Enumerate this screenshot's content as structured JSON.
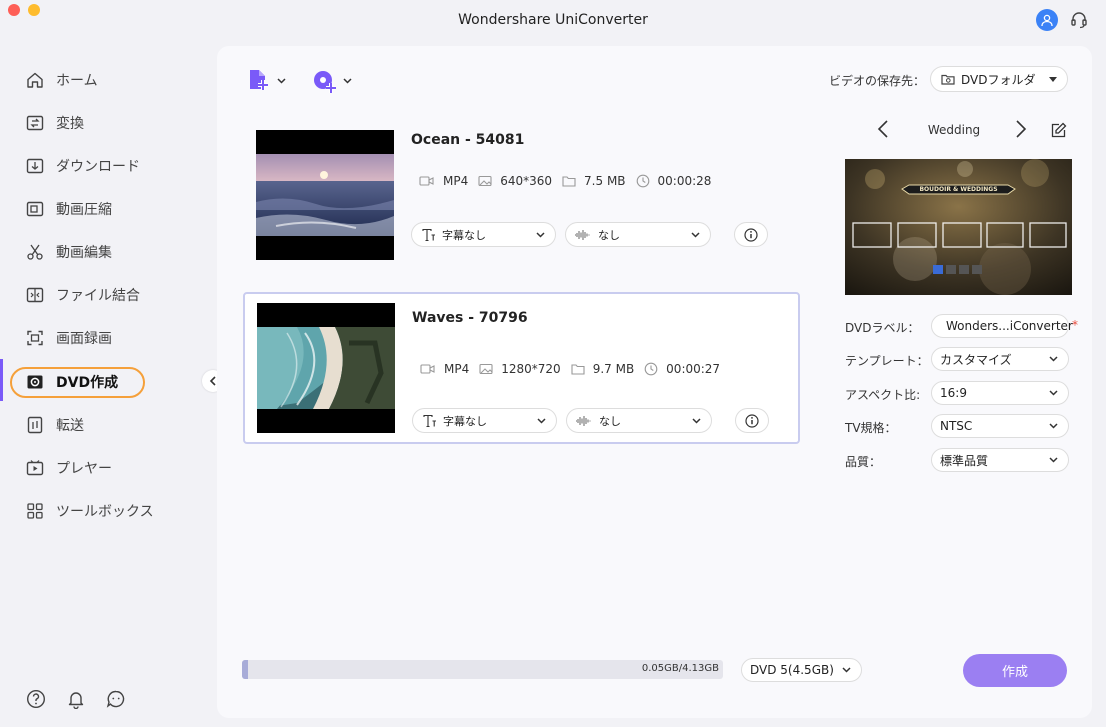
{
  "app": {
    "title": "Wondershare UniConverter"
  },
  "sidebar": {
    "items": [
      {
        "label": "ホーム",
        "icon": "home-icon"
      },
      {
        "label": "変換",
        "icon": "convert-icon"
      },
      {
        "label": "ダウンロード",
        "icon": "download-icon"
      },
      {
        "label": "動画圧縮",
        "icon": "compress-icon"
      },
      {
        "label": "動画編集",
        "icon": "scissors-icon"
      },
      {
        "label": "ファイル結合",
        "icon": "merge-icon"
      },
      {
        "label": "画面録画",
        "icon": "record-icon"
      },
      {
        "label": "DVD作成",
        "icon": "dvd-icon",
        "active": true
      },
      {
        "label": "転送",
        "icon": "transfer-icon"
      },
      {
        "label": "プレヤー",
        "icon": "player-icon"
      },
      {
        "label": "ツールボックス",
        "icon": "toolbox-icon"
      }
    ]
  },
  "toolbar": {
    "save_to_label": "ビデオの保存先：",
    "save_to_value": "DVDフォルダ"
  },
  "videos": [
    {
      "title": "Ocean - 54081",
      "format": "MP4",
      "resolution": "640*360",
      "size": "7.5 MB",
      "duration": "00:00:28",
      "subtitle": "字幕なし",
      "audio": "なし",
      "selected": false
    },
    {
      "title": "Waves - 70796",
      "format": "MP4",
      "resolution": "1280*720",
      "size": "9.7 MB",
      "duration": "00:00:27",
      "subtitle": "字幕なし",
      "audio": "なし",
      "selected": true
    }
  ],
  "template": {
    "name": "Wedding",
    "preview_banner": "BOUDOIR & WEDDINGS"
  },
  "settings": {
    "label_label": "DVDラベル：",
    "label_value": "Wonders...iConverter",
    "required_mark": "*",
    "template_label": "テンプレート：",
    "template_value": "カスタマイズ",
    "aspect_label": "アスペクト比:",
    "aspect_value": "16:9",
    "tv_label": "TV規格：",
    "tv_value": "NTSC",
    "quality_label": "品質：",
    "quality_value": "標準品質"
  },
  "bottom": {
    "progress_text": "0.05GB/4.13GB",
    "progress_fraction": 0.012,
    "disc_value": "DVD 5(4.5GB)",
    "create_label": "作成"
  },
  "colors": {
    "accent": "#7a5af8",
    "create_button": "#9b7ff2",
    "active_ring": "#f5a03a",
    "avatar": "#3b82f6"
  }
}
